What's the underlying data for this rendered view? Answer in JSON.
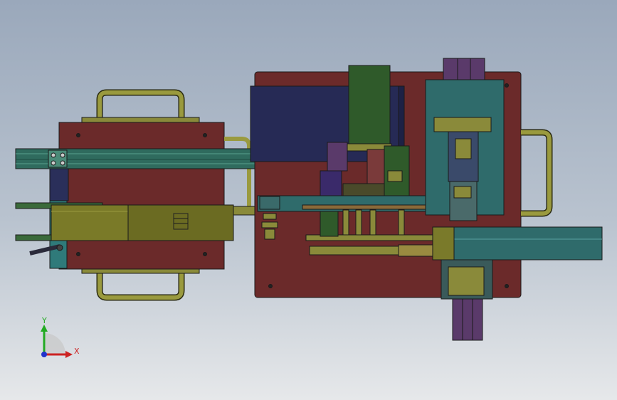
{
  "viewport": {
    "background_top": "#9aa8bb",
    "background_bottom": "#e6e8ea"
  },
  "triad": {
    "y_label": "Y",
    "x_label": "X",
    "y_color": "#22aa22",
    "x_color": "#cc2222",
    "z_color": "#2233cc"
  },
  "colors": {
    "plate": "#6b2a2a",
    "plate_dark": "#4a1a1a",
    "handle": "#8a8a3a",
    "rail": "#2f6b5e",
    "olive": "#6b6b2a",
    "navy": "#2a2f5a",
    "green_block": "#2f5a2a",
    "purple": "#5a3a6a",
    "teal": "#2f6b6b",
    "outline": "#1a1a1a"
  }
}
